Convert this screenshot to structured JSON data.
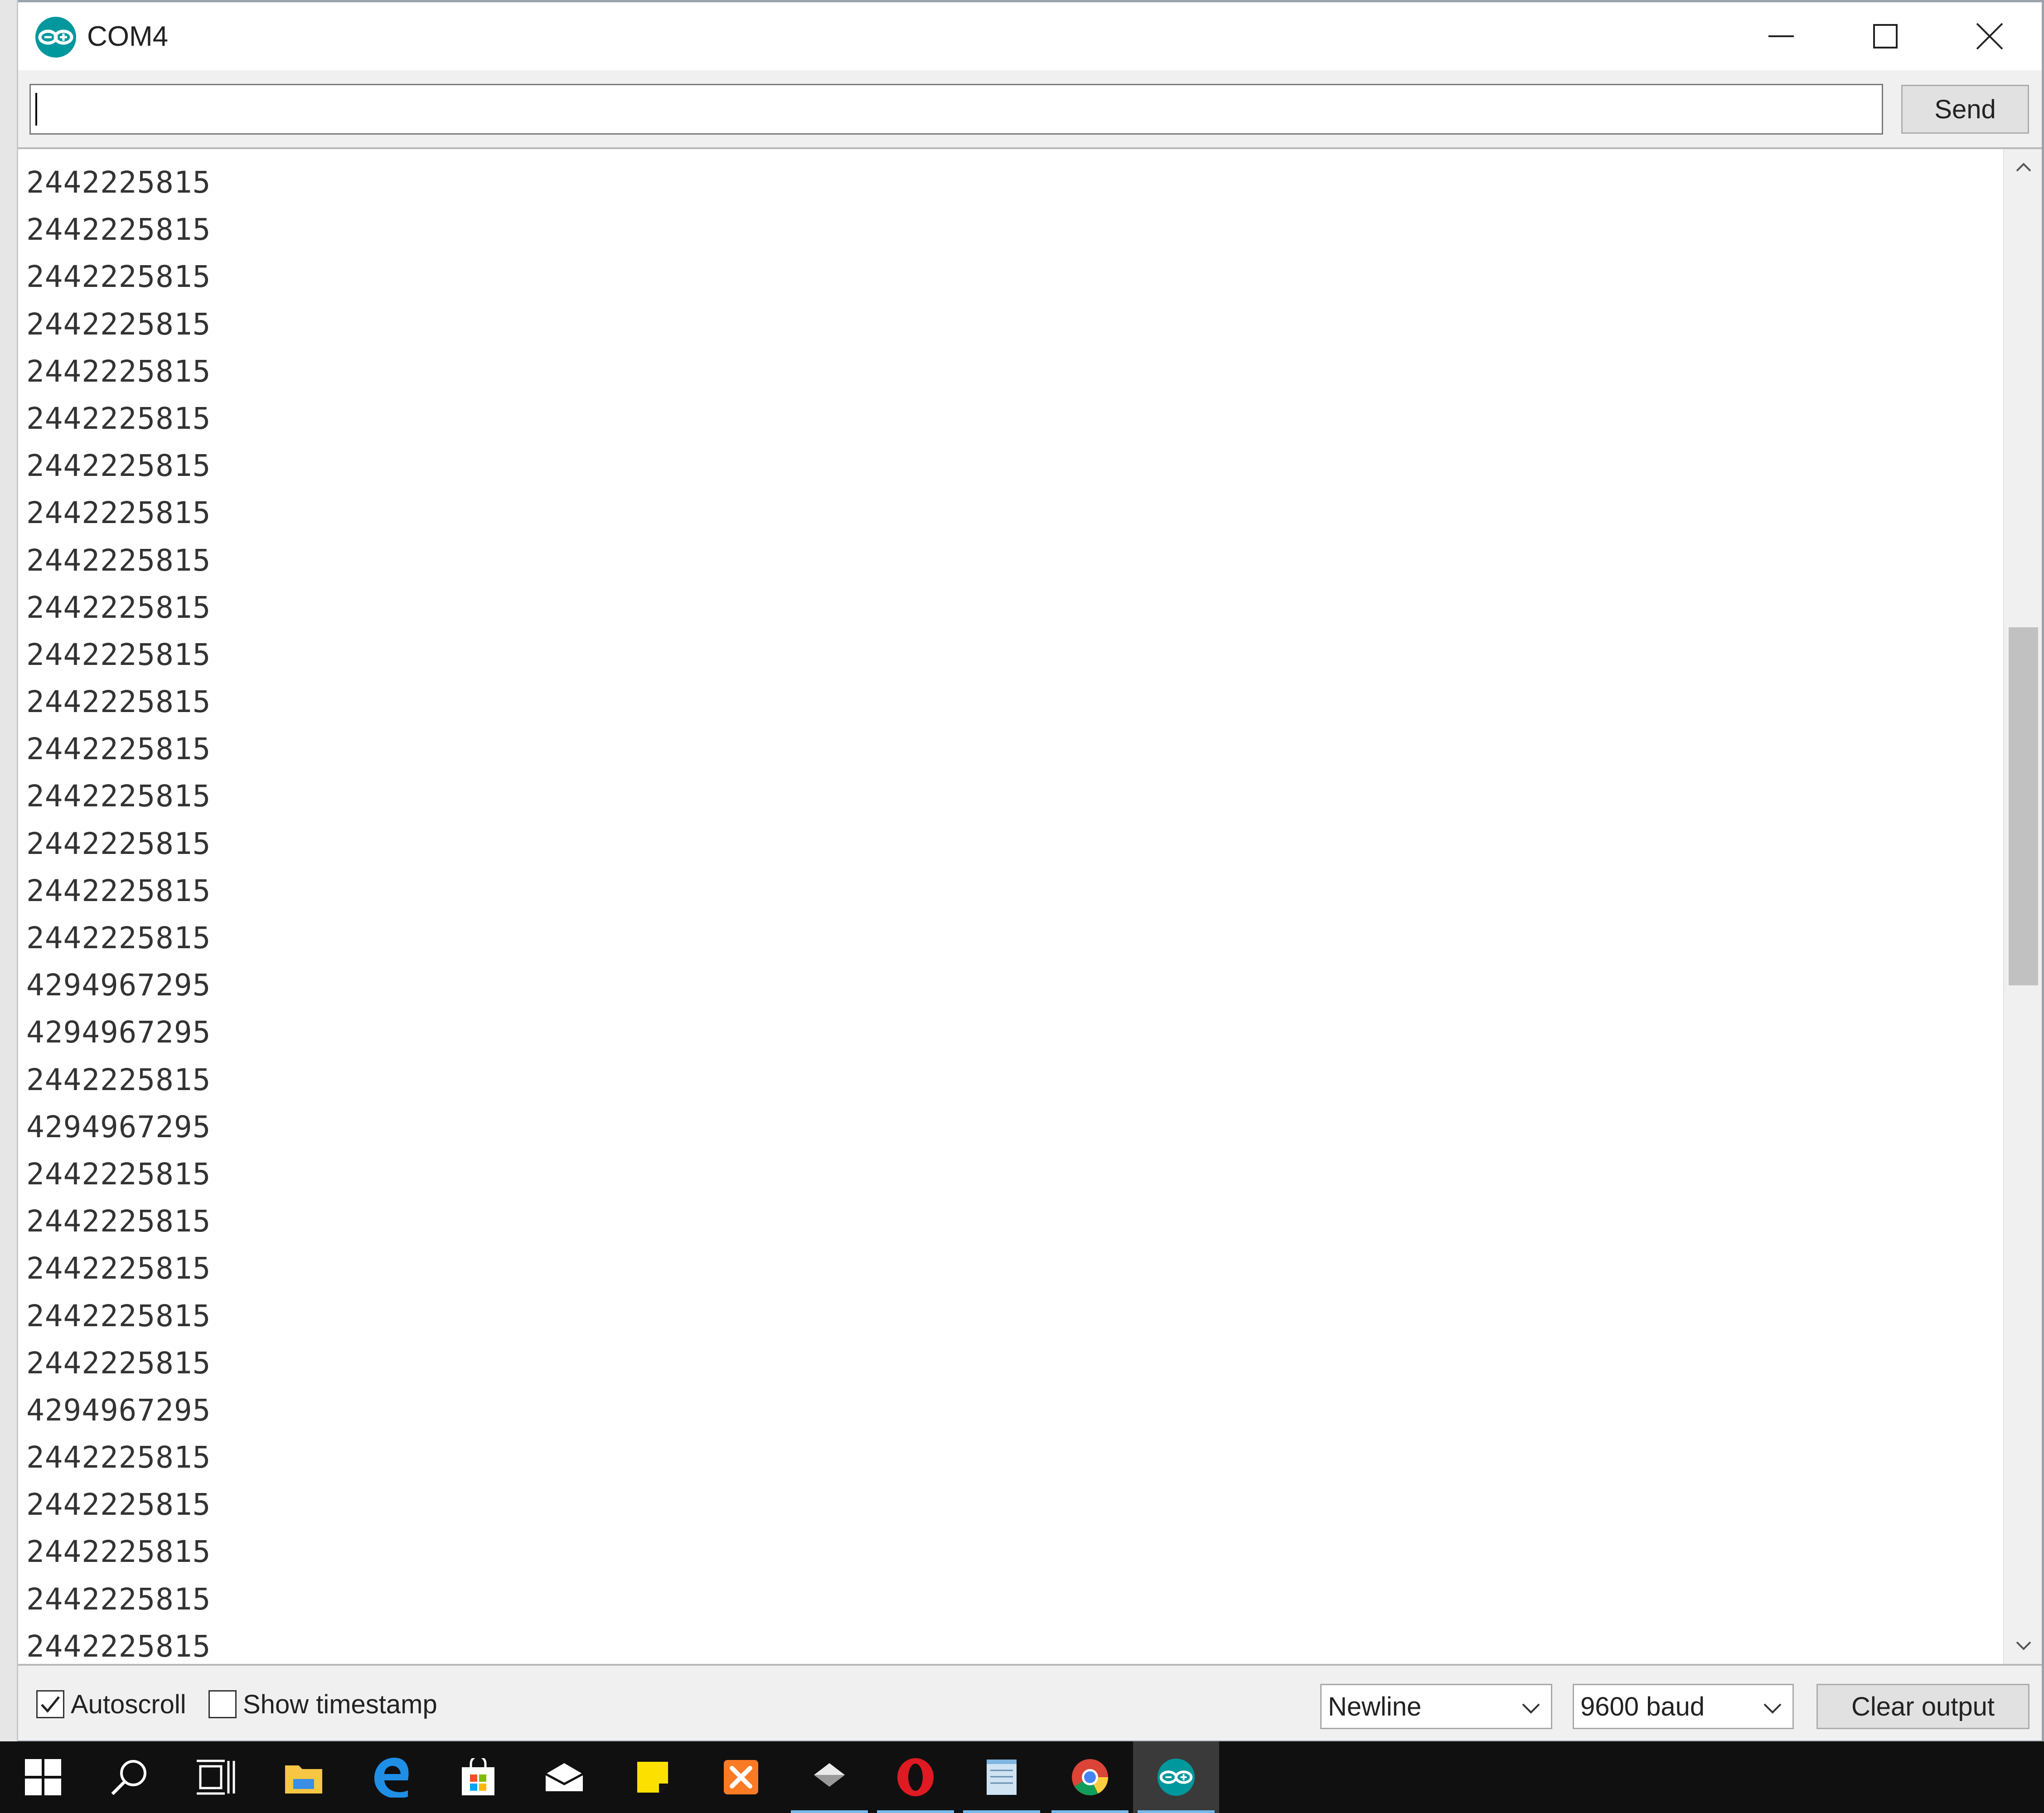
{
  "window": {
    "title": "COM4",
    "icon": "arduino-logo-icon"
  },
  "send_row": {
    "input_value": "",
    "send_label": "Send"
  },
  "output": {
    "lines": [
      "2442225815",
      "2442225815",
      "2442225815",
      "2442225815",
      "2442225815",
      "2442225815",
      "2442225815",
      "2442225815",
      "2442225815",
      "2442225815",
      "2442225815",
      "2442225815",
      "2442225815",
      "2442225815",
      "2442225815",
      "2442225815",
      "2442225815",
      "4294967295",
      "4294967295",
      "2442225815",
      "4294967295",
      "2442225815",
      "2442225815",
      "2442225815",
      "2442225815",
      "2442225815",
      "4294967295",
      "2442225815",
      "2442225815",
      "2442225815",
      "2442225815",
      "2442225815"
    ]
  },
  "bottom_bar": {
    "autoscroll_label": "Autoscroll",
    "autoscroll_checked": true,
    "timestamp_label": "Show timestamp",
    "timestamp_checked": false,
    "line_ending": "Newline",
    "baud": "9600 baud",
    "clear_label": "Clear output"
  },
  "taskbar": {
    "items": [
      "windows-start-icon",
      "search-icon",
      "task-view-icon",
      "file-explorer-icon",
      "edge-icon",
      "store-icon",
      "mail-icon",
      "sticky-notes-icon",
      "xampp-icon",
      "app-icon",
      "opera-icon",
      "notepad-icon",
      "chrome-icon",
      "arduino-icon"
    ]
  },
  "colors": {
    "arduino_teal": "#00979d",
    "taskbar_bg": "#101010",
    "accent_underline": "#76b9ed"
  }
}
